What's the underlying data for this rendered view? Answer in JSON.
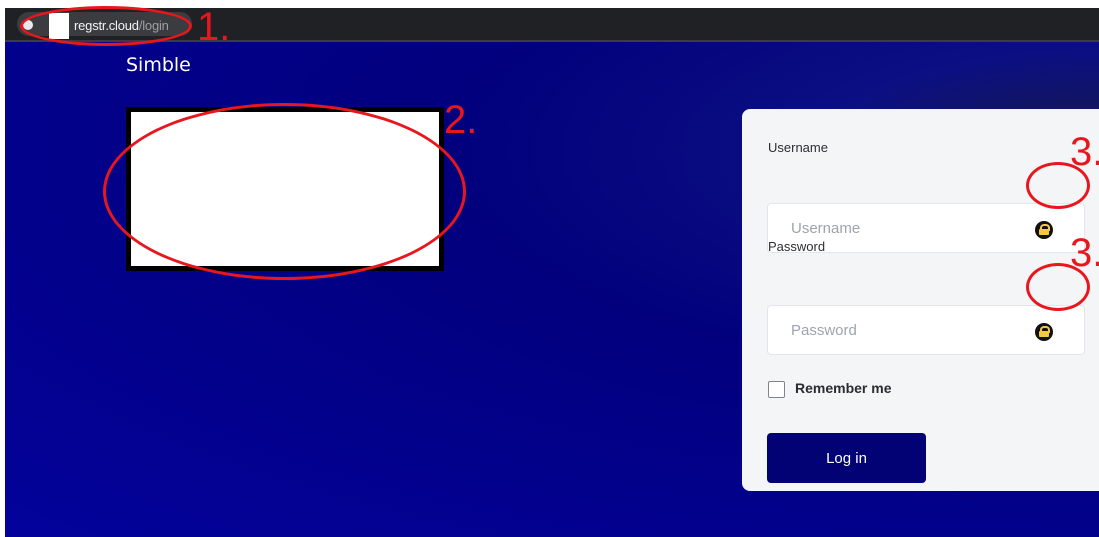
{
  "browser": {
    "url_domain": "regstr.cloud",
    "url_path": "/login"
  },
  "page": {
    "brand": "Simble"
  },
  "login_form": {
    "username": {
      "label": "Username",
      "placeholder": "Username",
      "value": ""
    },
    "password": {
      "label": "Password",
      "placeholder": "Password",
      "value": ""
    },
    "remember_me": {
      "label": "Remember me",
      "checked": false
    },
    "submit_label": "Log in",
    "password_manager_icon": "lock-icon"
  },
  "annotations": {
    "markers": [
      "1.",
      "2.",
      "3.",
      "3."
    ],
    "color": "#e8161d"
  },
  "colors": {
    "page_background": "#02007d",
    "card_background": "#f4f5f7",
    "button_background": "#030275",
    "annotation_red": "#e8161d"
  }
}
